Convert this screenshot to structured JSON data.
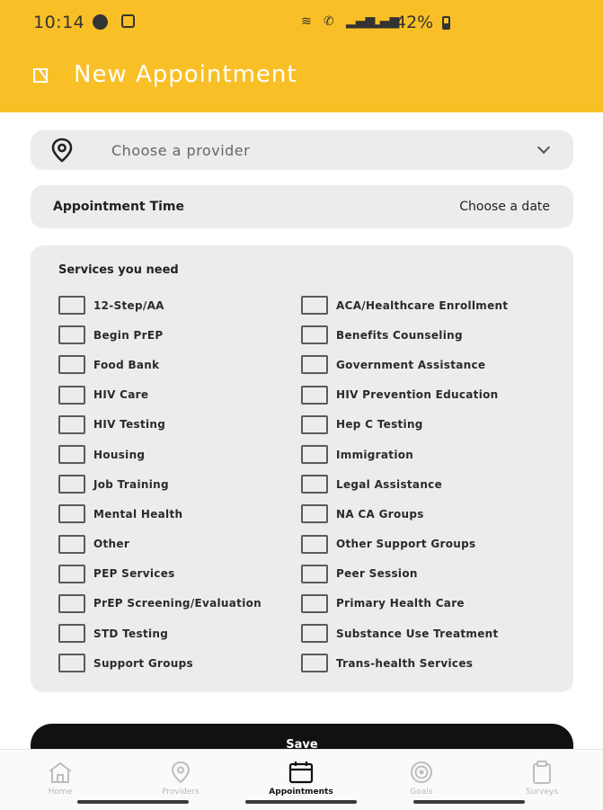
{
  "status_bar": {
    "time": "10:14",
    "battery": "42%"
  },
  "header": {
    "title": "New Appointment"
  },
  "provider": {
    "placeholder": "Choose a provider"
  },
  "appointment": {
    "label": "Appointment Time",
    "value": "Choose a date"
  },
  "services": {
    "title": "Services you need",
    "left": [
      "12-Step/AA",
      "Begin PrEP",
      "Food Bank",
      "HIV Care",
      "HIV Testing",
      "Housing",
      "Job Training",
      "Mental Health",
      "Other",
      "PEP Services",
      "PrEP Screening/Evaluation",
      "STD Testing",
      "Support Groups"
    ],
    "right": [
      "ACA/Healthcare Enrollment",
      "Benefits Counseling",
      "Government Assistance",
      "HIV Prevention Education",
      "Hep C Testing",
      "Immigration",
      "Legal Assistance",
      "NA CA Groups",
      "Other Support Groups",
      "Peer Session",
      "Primary Health Care",
      "Substance Use Treatment",
      "Trans-health Services"
    ]
  },
  "save_label": "Save",
  "tabs": [
    {
      "label": "Home",
      "icon": "home-icon"
    },
    {
      "label": "Providers",
      "icon": "location-pin-icon"
    },
    {
      "label": "Appointments",
      "icon": "calendar-icon"
    },
    {
      "label": "Goals",
      "icon": "target-icon"
    },
    {
      "label": "Surveys",
      "icon": "clipboard-icon"
    }
  ],
  "colors": {
    "header": "#f9bf26",
    "card": "#ececed",
    "button": "#111111"
  }
}
